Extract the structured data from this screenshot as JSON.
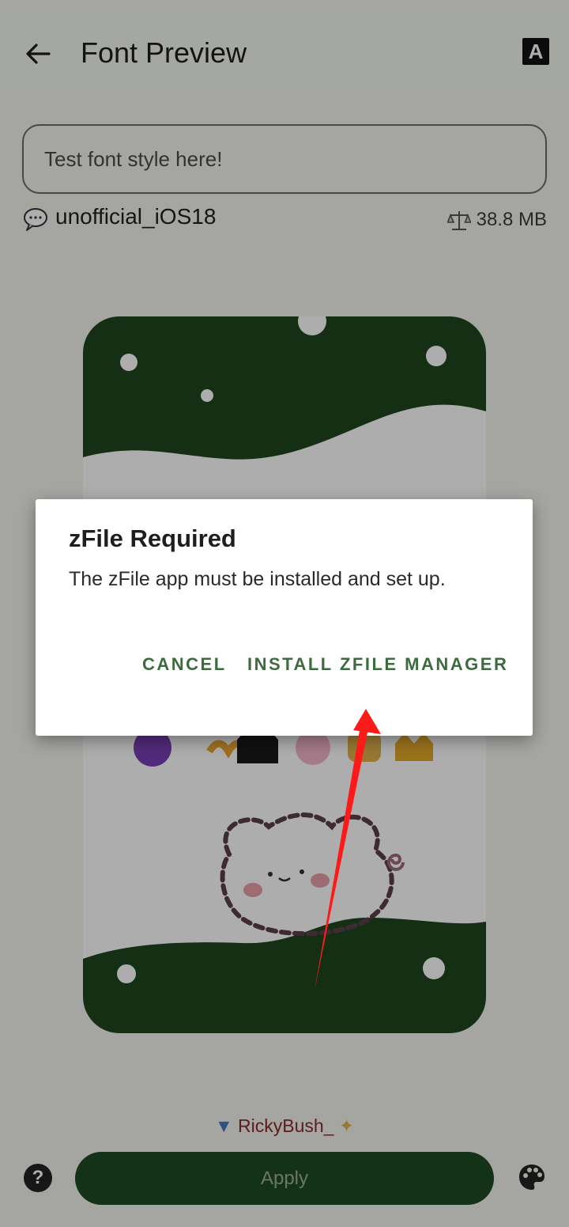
{
  "appbar": {
    "title": "Font Preview",
    "font_badge": "A"
  },
  "input": {
    "placeholder": "Test font style here!"
  },
  "meta": {
    "font_name": "unofficial_iOS18",
    "size": "38.8 MB"
  },
  "footer": {
    "credit": "RickyBush_",
    "apply_label": "Apply",
    "help_label": "?"
  },
  "dialog": {
    "title": "zFile Required",
    "message": "The zFile app must be installed and set up.",
    "cancel_label": "CANCEL",
    "install_label": "INSTALL ZFILE MANAGER"
  },
  "colors": {
    "accent": "#1e4a22",
    "dialog_button": "#3c6b3f",
    "annotation_arrow": "#ff1a1a"
  },
  "icons": {
    "back": "arrow-left-icon",
    "speech": "speech-bubble-icon",
    "scale": "balance-scale-icon",
    "help": "help-icon",
    "palette": "palette-icon"
  }
}
